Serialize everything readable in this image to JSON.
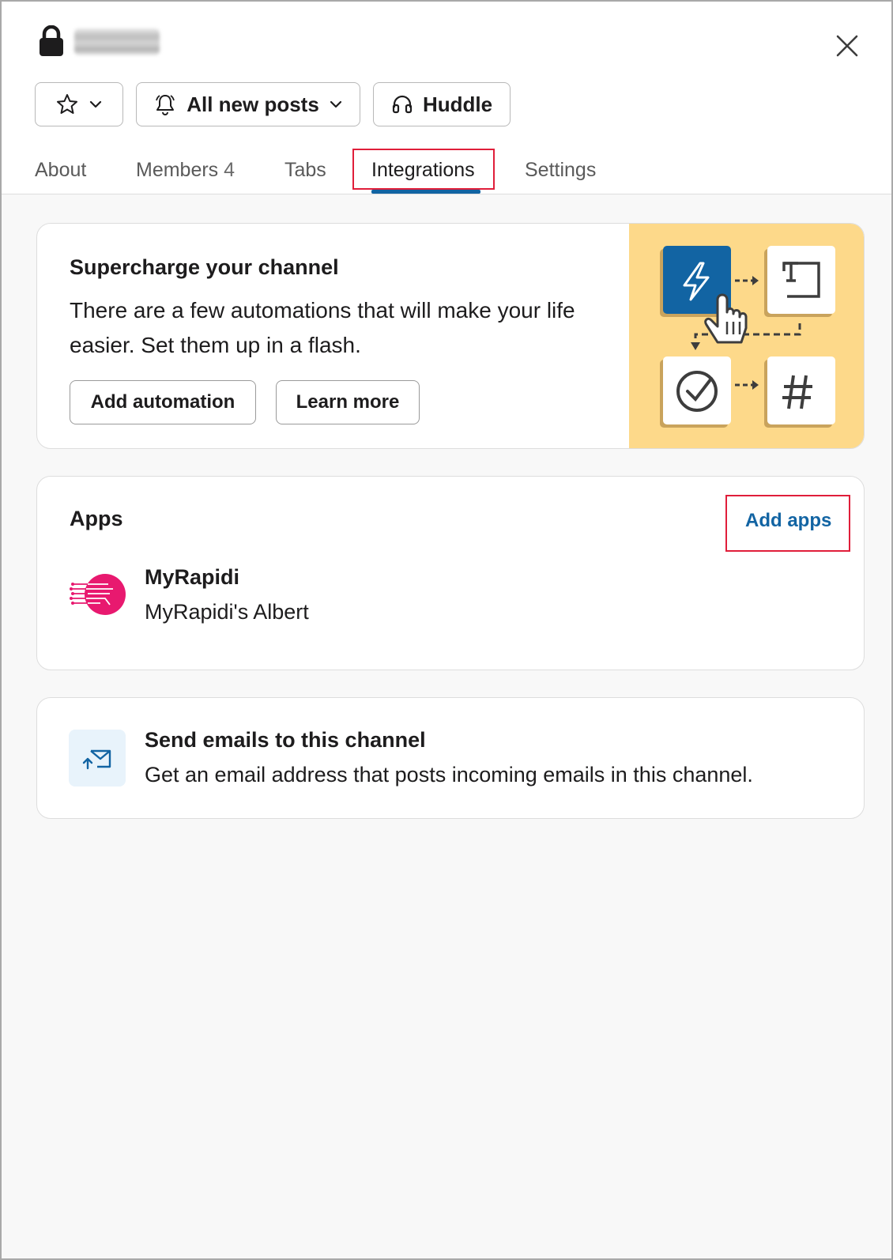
{
  "header": {
    "channel_name": "private-channel",
    "close_label": "Close"
  },
  "toolbar": {
    "notifications_label": "All new posts",
    "huddle_label": "Huddle"
  },
  "tabs": [
    {
      "label": "About"
    },
    {
      "label": "Members",
      "count": "4"
    },
    {
      "label": "Tabs"
    },
    {
      "label": "Integrations",
      "active": true
    },
    {
      "label": "Settings"
    }
  ],
  "promo": {
    "title": "Supercharge your channel",
    "description": "There are a few automations that will make your life easier. Set them up in a flash.",
    "add_automation_label": "Add automation",
    "learn_more_label": "Learn more",
    "art_bg_color": "#fdd98a",
    "art_accent_color": "#1264a3"
  },
  "apps": {
    "title": "Apps",
    "add_apps_label": "Add apps",
    "items": [
      {
        "name": "MyRapidi",
        "subtitle": "MyRapidi's Albert",
        "logo_color": "#e8196f"
      }
    ]
  },
  "email": {
    "title": "Send emails to this channel",
    "description": "Get an email address that posts incoming emails in this channel."
  },
  "colors": {
    "link": "#1264a3",
    "highlight_box": "#e01e3a",
    "active_tab_underline": "#1264a3"
  }
}
